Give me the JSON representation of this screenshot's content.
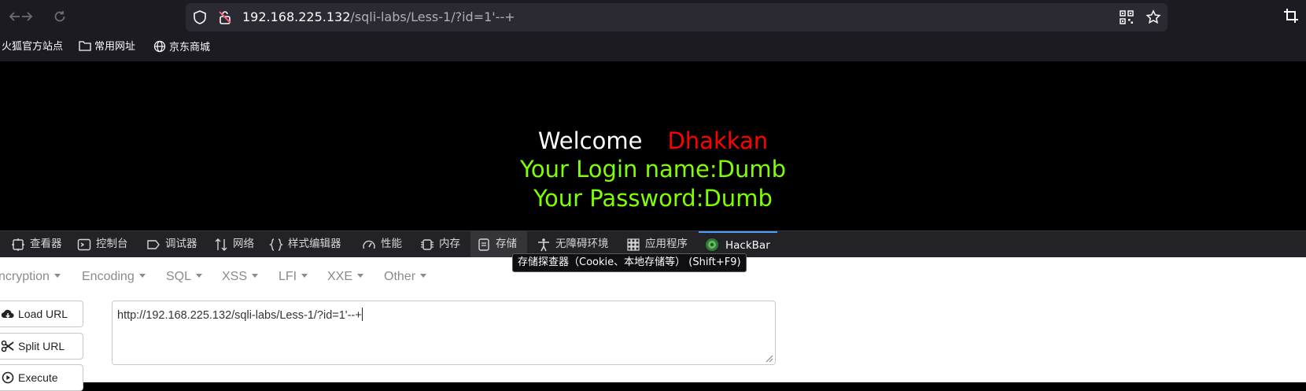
{
  "toolbar": {
    "back_icon": "arrow-left-icon",
    "forward_icon": "arrow-right-icon",
    "reload_icon": "reload-icon",
    "url_host": "192.168.225.132",
    "url_path": "/sqli-labs/Less-1/?id=1'--+"
  },
  "bookmarks": {
    "items": [
      {
        "label": "火狐官方站点",
        "icon": "firefox-icon"
      },
      {
        "label": "常用网址",
        "icon": "folder-icon"
      },
      {
        "label": "京东商城",
        "icon": "globe-icon"
      }
    ]
  },
  "page": {
    "welcome": "Welcome",
    "name": "Dhakkan",
    "login_line": "Your Login name:Dumb",
    "password_line": "Your Password:Dumb",
    "colors": {
      "welcome": "#ffffff",
      "name": "#ff0000",
      "result": "#7fff00"
    }
  },
  "devtools": {
    "tabs": [
      {
        "label": "查看器",
        "icon": "inspector-icon"
      },
      {
        "label": "控制台",
        "icon": "console-icon"
      },
      {
        "label": "调试器",
        "icon": "debugger-icon"
      },
      {
        "label": "网络",
        "icon": "network-icon"
      },
      {
        "label": "样式编辑器",
        "icon": "style-editor-icon"
      },
      {
        "label": "性能",
        "icon": "performance-icon"
      },
      {
        "label": "内存",
        "icon": "memory-icon"
      },
      {
        "label": "存储",
        "icon": "storage-icon"
      },
      {
        "label": "无障碍环境",
        "icon": "accessibility-icon"
      },
      {
        "label": "应用程序",
        "icon": "application-icon"
      },
      {
        "label": "HackBar",
        "icon": "hackbar-icon"
      }
    ],
    "tooltip": "存储探查器（Cookie、本地存储等） (Shift+F9)"
  },
  "hackbar": {
    "menus": [
      "ncryption",
      "Encoding",
      "SQL",
      "XSS",
      "LFI",
      "XXE",
      "Other"
    ],
    "buttons": {
      "load_url": "Load URL",
      "split_url": "Split URL",
      "execute": "Execute"
    },
    "url_value": "http://192.168.225.132/sqli-labs/Less-1/?id=1'--+"
  }
}
